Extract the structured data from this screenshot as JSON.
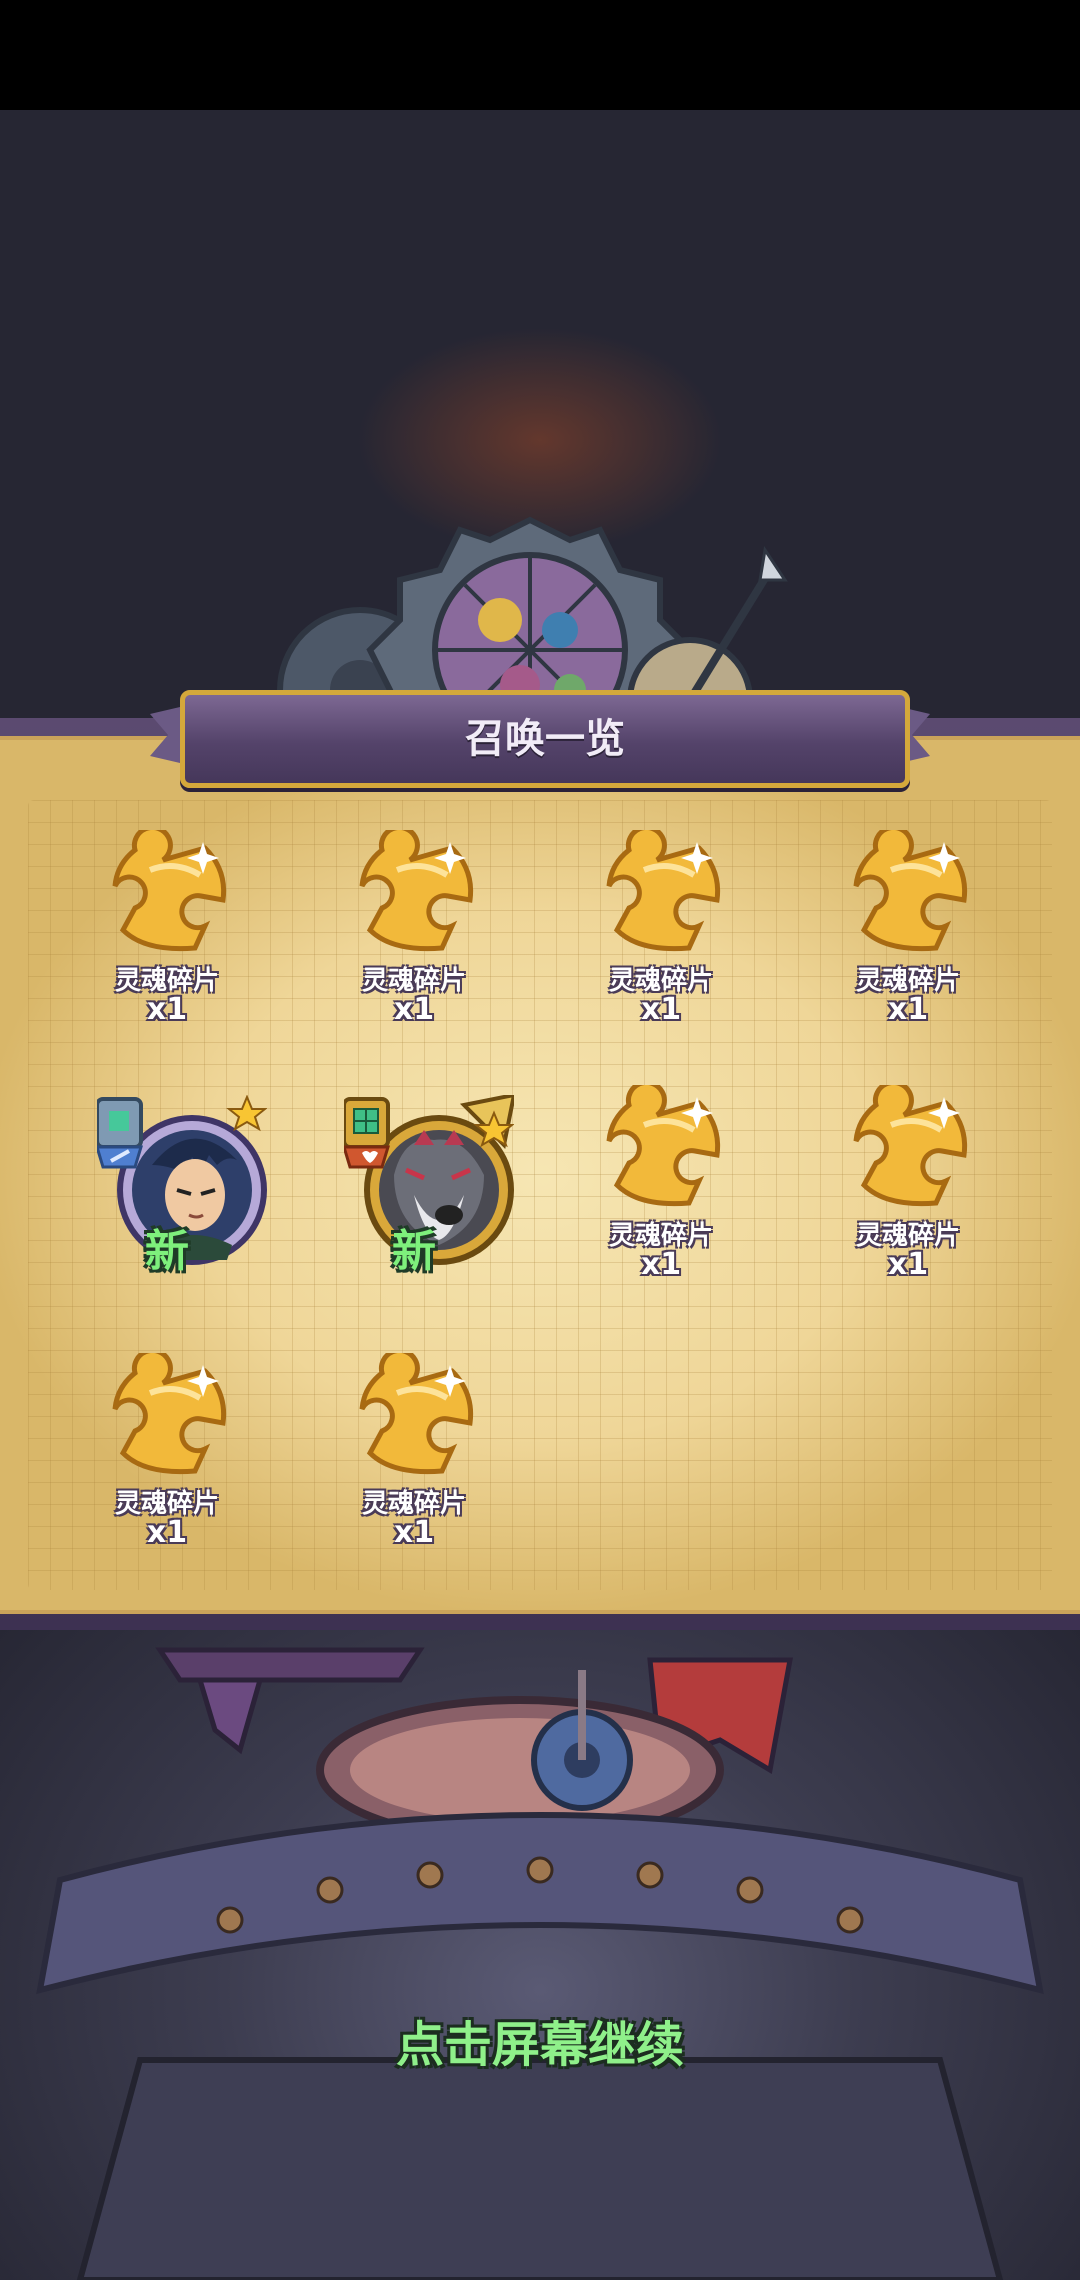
{
  "panel": {
    "title": "召唤一览"
  },
  "items": [
    {
      "type": "shard",
      "label": "灵魂碎片",
      "count": "x1",
      "icon": "soul-shard-icon"
    },
    {
      "type": "shard",
      "label": "灵魂碎片",
      "count": "x1",
      "icon": "soul-shard-icon"
    },
    {
      "type": "shard",
      "label": "灵魂碎片",
      "count": "x1",
      "icon": "soul-shard-icon"
    },
    {
      "type": "shard",
      "label": "灵魂碎片",
      "count": "x1",
      "icon": "soul-shard-icon"
    },
    {
      "type": "hero",
      "tag": "新",
      "icon": "hero-portrait-swordsman",
      "stars": 1
    },
    {
      "type": "hero",
      "tag": "新",
      "icon": "hero-portrait-wolf",
      "stars": 1
    },
    {
      "type": "shard",
      "label": "灵魂碎片",
      "count": "x1",
      "icon": "soul-shard-icon"
    },
    {
      "type": "shard",
      "label": "灵魂碎片",
      "count": "x1",
      "icon": "soul-shard-icon"
    },
    {
      "type": "shard",
      "label": "灵魂碎片",
      "count": "x1",
      "icon": "soul-shard-icon"
    },
    {
      "type": "shard",
      "label": "灵魂碎片",
      "count": "x1",
      "icon": "soul-shard-icon"
    }
  ],
  "footer": {
    "continue_text": "点击屏幕继续"
  },
  "colors": {
    "shard": "#f2b93a",
    "new_tag": "#7ef07c",
    "banner": "#5b4a70",
    "border_gold": "#d4a83b"
  }
}
